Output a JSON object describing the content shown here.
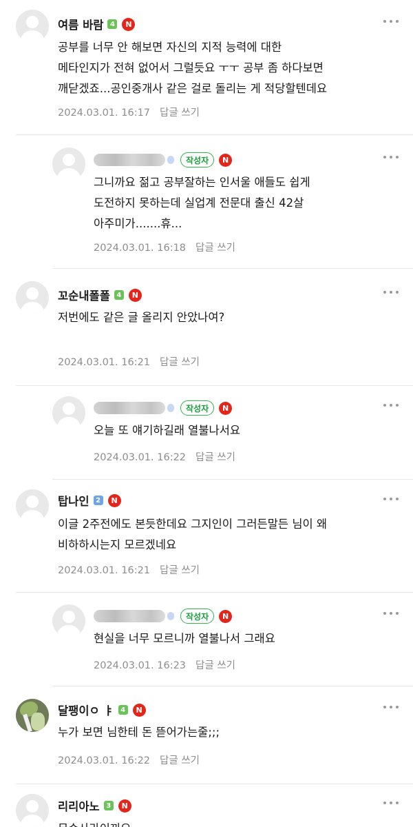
{
  "comments": [
    {
      "nickname": "여름 바람",
      "level": "4",
      "new_badge": "N",
      "text": "공부를 너무 안 해보면 자신의 지적 능력에 대한\n메타인지가 전혀 없어서 그럴듯요 ㅜㅜ 공부 좀 하다보면\n깨닫겠죠...공인중개사 같은 걸로 돌리는 게 적당할텐데요",
      "date": "2024.03.01. 16:17",
      "reply_label": "답글 쓰기"
    },
    {
      "writer_badge": "작성자",
      "new_badge": "N",
      "text": "그니까요 젊고 공부잘하는 인서울 애들도 쉽게\n도전하지 못하는데 실업계 전문대 출신 42살\n아주미가.......휴...",
      "date": "2024.03.01. 16:18",
      "reply_label": "답글 쓰기"
    },
    {
      "nickname": "꼬순내폴폴",
      "level": "4",
      "new_badge": "N",
      "text": "저번에도 같은 글 올리지 안았나여?",
      "date": "2024.03.01. 16:21",
      "reply_label": "답글 쓰기"
    },
    {
      "writer_badge": "작성자",
      "new_badge": "N",
      "text": "오늘 또 얘기하길래 열불나서요",
      "date": "2024.03.01. 16:22",
      "reply_label": "답글 쓰기"
    },
    {
      "nickname": "탑나인",
      "level": "2",
      "new_badge": "N",
      "text": "이글 2주전에도 본듯한데요 그지인이 그러든말든 님이 왜\n비하하시는지 모르겠네요",
      "date": "2024.03.01. 16:21",
      "reply_label": "답글 쓰기"
    },
    {
      "writer_badge": "작성자",
      "new_badge": "N",
      "text": "현실을 너무 모르니까 열불나서 그래요",
      "date": "2024.03.01. 16:23",
      "reply_label": "답글 쓰기"
    },
    {
      "nickname": "달팽이ㅇ ㅑ",
      "level": "4",
      "new_badge": "N",
      "text": "누가 보면 님한테 돈 뜯어가는줄;;;",
      "date": "2024.03.01. 16:22",
      "reply_label": "답글 쓰기"
    },
    {
      "nickname": "리리아노",
      "level": "3",
      "new_badge": "N",
      "text": "무슨사라이끼요",
      "date": "",
      "reply_label": ""
    }
  ],
  "colors": {
    "level_badge": "#6ac259",
    "level_badge_blue": "#6fa4e6",
    "new_badge": "#e2261c",
    "writer_badge": "#1a9d3b",
    "meta_text": "#8d8d8d"
  },
  "icons": {
    "avatar": "default-profile-icon",
    "more": "more-vertical-icon"
  }
}
